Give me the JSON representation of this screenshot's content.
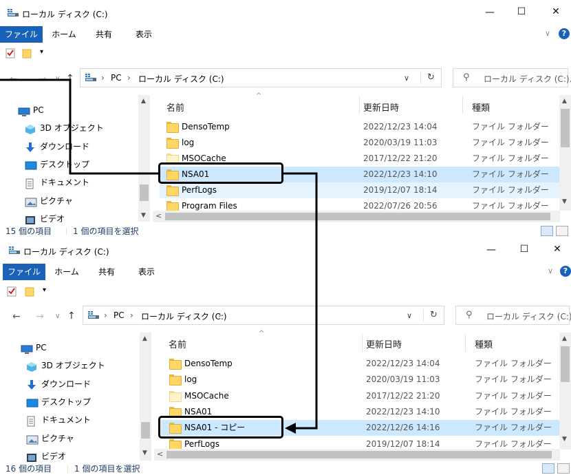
{
  "windows": [
    {
      "title": "ローカル ディスク (C:)",
      "caption": {
        "minimize": "—",
        "maximize": "☐",
        "close": "✕"
      },
      "ribbon_tabs": [
        {
          "label": "ファイル",
          "active": true
        },
        {
          "label": "ホーム",
          "active": false
        },
        {
          "label": "共有",
          "active": false
        },
        {
          "label": "表示",
          "active": false
        }
      ],
      "breadcrumb": [
        {
          "label": "PC"
        },
        {
          "label": "ローカル ディスク (C:)"
        }
      ],
      "search_placeholder": "ローカル ディスク (C:)...",
      "nav_items": [
        {
          "label": "PC",
          "icon": "pc-icon"
        },
        {
          "label": "3D オブジェクト",
          "icon": "3d-objects-icon"
        },
        {
          "label": "ダウンロード",
          "icon": "download-icon"
        },
        {
          "label": "デスクトップ",
          "icon": "desktop-icon"
        },
        {
          "label": "ドキュメント",
          "icon": "document-icon"
        },
        {
          "label": "ピクチャ",
          "icon": "pictures-icon"
        },
        {
          "label": "ビデオ",
          "icon": "video-icon"
        }
      ],
      "columns": {
        "name": "名前",
        "date": "更新日時",
        "type": "種類"
      },
      "files": [
        {
          "name": "DensoTemp",
          "date": "2022/12/23 14:04",
          "type": "ファイル フォルダー",
          "state": "normal",
          "pale": false
        },
        {
          "name": "log",
          "date": "2020/03/19 11:03",
          "type": "ファイル フォルダー",
          "state": "normal",
          "pale": false
        },
        {
          "name": "MSOCache",
          "date": "2017/12/22 21:20",
          "type": "ファイル フォルダー",
          "state": "normal",
          "pale": true
        },
        {
          "name": "NSA01",
          "date": "2022/12/23 14:10",
          "type": "ファイル フォルダー",
          "state": "selected",
          "pale": false
        },
        {
          "name": "PerfLogs",
          "date": "2019/12/07 18:14",
          "type": "ファイル フォルダー",
          "state": "hover",
          "pale": false
        },
        {
          "name": "Program Files",
          "date": "2022/07/26 20:56",
          "type": "ファイル フォルダー",
          "state": "normal",
          "pale": false
        }
      ],
      "status": {
        "count": "15 個の項目",
        "selected": "1 個の項目を選択"
      }
    },
    {
      "title": "ローカル ディスク (C:)",
      "caption": {
        "minimize": "—",
        "maximize": "☐",
        "close": "✕"
      },
      "ribbon_tabs": [
        {
          "label": "ファイル",
          "active": true
        },
        {
          "label": "ホーム",
          "active": false
        },
        {
          "label": "共有",
          "active": false
        },
        {
          "label": "表示",
          "active": false
        }
      ],
      "breadcrumb": [
        {
          "label": "PC"
        },
        {
          "label": "ローカル ディスク (C:)"
        }
      ],
      "search_placeholder": "ローカル ディスク (C:)...",
      "nav_items": [
        {
          "label": "PC",
          "icon": "pc-icon"
        },
        {
          "label": "3D オブジェクト",
          "icon": "3d-objects-icon"
        },
        {
          "label": "ダウンロード",
          "icon": "download-icon"
        },
        {
          "label": "デスクトップ",
          "icon": "desktop-icon"
        },
        {
          "label": "ドキュメント",
          "icon": "document-icon"
        },
        {
          "label": "ピクチャ",
          "icon": "pictures-icon"
        },
        {
          "label": "ビデオ",
          "icon": "video-icon"
        }
      ],
      "columns": {
        "name": "名前",
        "date": "更新日時",
        "type": "種類"
      },
      "files": [
        {
          "name": "DensoTemp",
          "date": "2022/12/23 14:04",
          "type": "ファイル フォルダー",
          "state": "normal",
          "pale": false
        },
        {
          "name": "log",
          "date": "2020/03/19 11:03",
          "type": "ファイル フォルダー",
          "state": "normal",
          "pale": false
        },
        {
          "name": "MSOCache",
          "date": "2017/12/22 21:20",
          "type": "ファイル フォルダー",
          "state": "normal",
          "pale": true
        },
        {
          "name": "NSA01",
          "date": "2022/12/23 14:10",
          "type": "ファイル フォルダー",
          "state": "normal",
          "pale": false
        },
        {
          "name": "NSA01 - コピー",
          "date": "2022/12/26 14:16",
          "type": "ファイル フォルダー",
          "state": "selected",
          "pale": false
        },
        {
          "name": "PerfLogs",
          "date": "2019/12/07 18:14",
          "type": "ファイル フォルダー",
          "state": "normal",
          "pale": false
        }
      ],
      "status": {
        "count": "16 個の項目",
        "selected": "1 個の項目を選択"
      }
    }
  ],
  "colors": {
    "accent": "#1a62b8",
    "selection": "#cce8ff",
    "hover": "#e5f3ff",
    "callout": "#000000"
  }
}
